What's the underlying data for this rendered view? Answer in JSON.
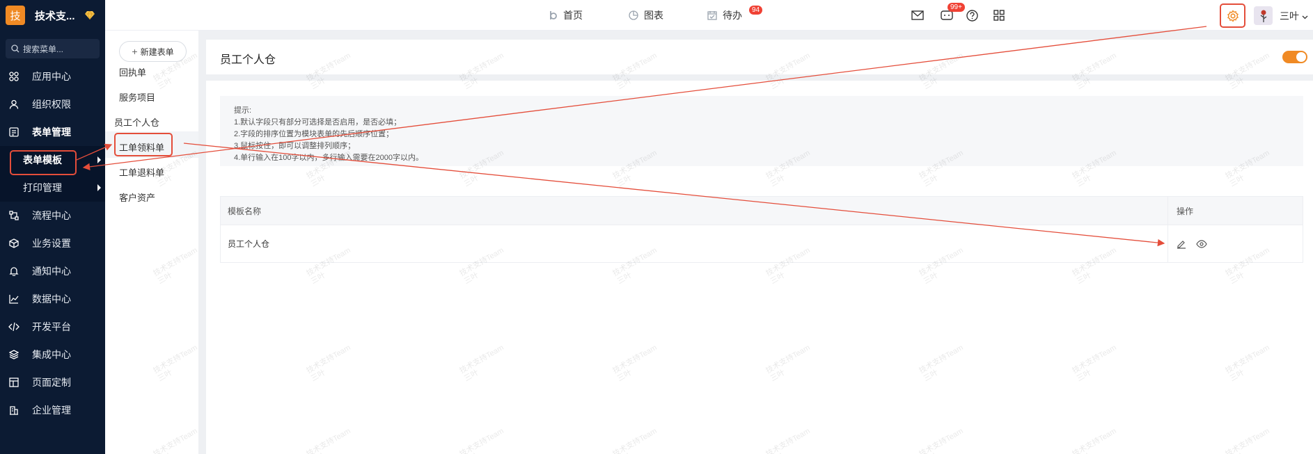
{
  "sidebar": {
    "logo_char": "技",
    "brand_name": "技术支...",
    "search_placeholder": "搜索菜单...",
    "items": [
      {
        "label": "应用中心",
        "icon": "grid-icon"
      },
      {
        "label": "组织权限",
        "icon": "user-icon"
      },
      {
        "label": "表单管理",
        "icon": "form-icon"
      },
      {
        "label": "流程中心",
        "icon": "flow-icon"
      },
      {
        "label": "业务设置",
        "icon": "cube-icon"
      },
      {
        "label": "通知中心",
        "icon": "bell-icon"
      },
      {
        "label": "数据中心",
        "icon": "chart-icon"
      },
      {
        "label": "开发平台",
        "icon": "code-icon"
      },
      {
        "label": "集成中心",
        "icon": "layers-icon"
      },
      {
        "label": "页面定制",
        "icon": "layout-icon"
      },
      {
        "label": "企业管理",
        "icon": "building-icon"
      }
    ],
    "sub_items": [
      {
        "label": "表单模板"
      },
      {
        "label": "打印管理"
      }
    ]
  },
  "topbar": {
    "tabs": [
      {
        "label": "首页",
        "icon": "home-icon"
      },
      {
        "label": "图表",
        "icon": "pie-icon"
      },
      {
        "label": "待办",
        "icon": "calendar-icon",
        "badge": "94"
      }
    ],
    "message_badge": "99+",
    "user_name": "三叶"
  },
  "midcol": {
    "new_button": "新建表单",
    "forms": [
      "回执单",
      "服务项目",
      "员工个人仓",
      "工单领料单",
      "工单退料单",
      "客户资产"
    ]
  },
  "main": {
    "title": "员工个人仓",
    "tips": [
      "提示:",
      "1.默认字段只有部分可选择是否启用，是否必填；",
      "2.字段的排序位置为模块表单的先后顺序位置；",
      "3.鼠标按住，即可以调整排列顺序；",
      "4.单行输入在100字以内，多行输入需要在2000字以内。"
    ],
    "table": {
      "headers": [
        "模板名称",
        "操作"
      ],
      "rows": [
        {
          "name": "员工个人仓"
        }
      ]
    }
  },
  "watermark": {
    "line1": "技术支持Team",
    "line2": "三叶"
  },
  "colors": {
    "accent": "#f08a24",
    "sidebar_bg": "#0c1b33",
    "annotation": "#e44d3a"
  }
}
